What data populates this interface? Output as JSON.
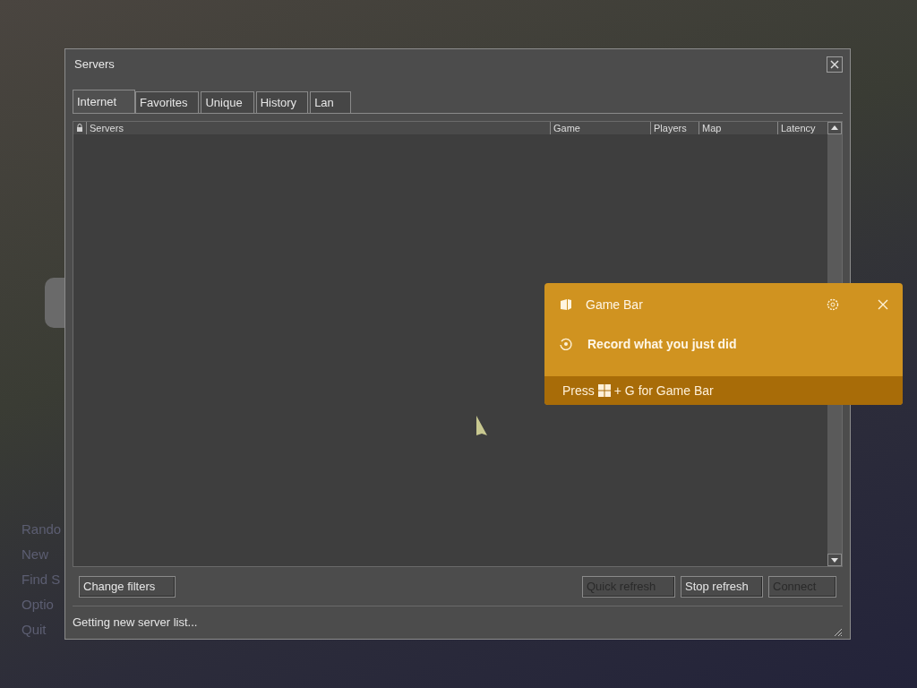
{
  "background_menu": [
    "Rando",
    "New",
    "Find S",
    "Optio",
    "Quit"
  ],
  "window": {
    "title": "Servers"
  },
  "tabs": [
    {
      "label": "Internet",
      "selected": true
    },
    {
      "label": "Favorites",
      "selected": false
    },
    {
      "label": "Unique",
      "selected": false
    },
    {
      "label": "History",
      "selected": false
    },
    {
      "label": "Lan",
      "selected": false
    }
  ],
  "table": {
    "columns": [
      "Servers",
      "Game",
      "Players",
      "Map",
      "Latency"
    ]
  },
  "buttons": [
    {
      "label": "Change filters",
      "disabled": false
    },
    {
      "label": "Quick refresh",
      "disabled": true
    },
    {
      "label": "Stop refresh",
      "disabled": false
    },
    {
      "label": "Connect",
      "disabled": true
    }
  ],
  "status_bar": "Getting new server list...",
  "toast": {
    "title": "Game Bar",
    "action": "Record what you just did",
    "hint_before": "Press",
    "hint_after": "+ G for Game Bar"
  }
}
